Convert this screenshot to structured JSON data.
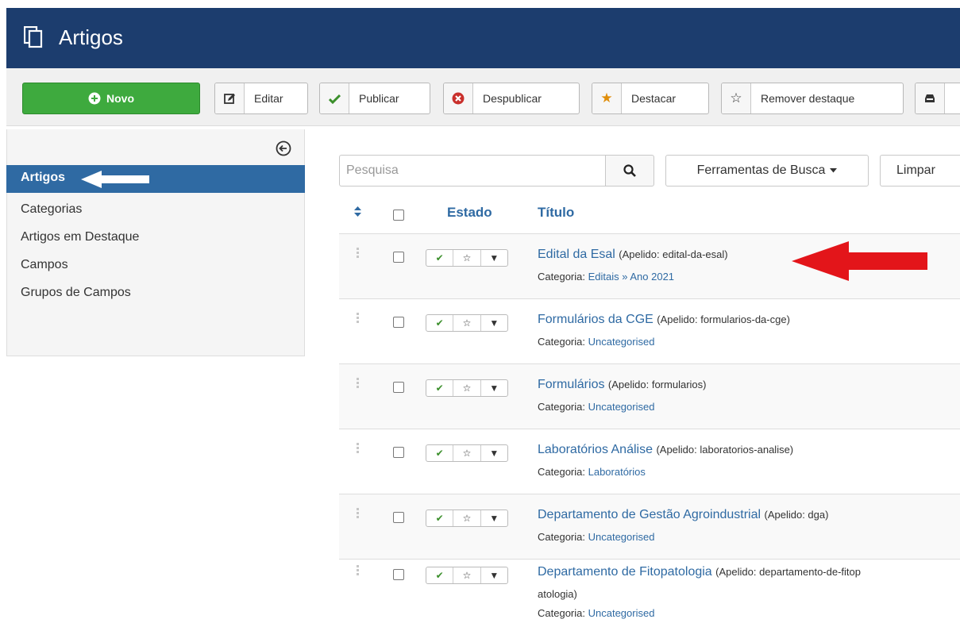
{
  "header": {
    "title": "Artigos",
    "icon": "copy-icon",
    "bg_color": "#1c3d6e"
  },
  "toolbar": {
    "new_label": "Novo",
    "edit_label": "Editar",
    "publish_label": "Publicar",
    "unpublish_label": "Despublicar",
    "feature_label": "Destacar",
    "unfeature_label": "Remover destaque"
  },
  "sidebar": {
    "items": [
      {
        "label": "Artigos",
        "active": true
      },
      {
        "label": "Categorias"
      },
      {
        "label": "Artigos em Destaque"
      },
      {
        "label": "Campos"
      },
      {
        "label": "Grupos de Campos"
      }
    ]
  },
  "search": {
    "placeholder": "Pesquisa",
    "tools_label": "Ferramentas de Busca",
    "clear_label": "Limpar"
  },
  "table": {
    "headers": {
      "state": "Estado",
      "title": "Título"
    },
    "alias_prefix": "Apelido:",
    "category_prefix": "Categoria:",
    "rows": [
      {
        "title": "Edital da Esal",
        "alias": "(Apelido: edital-da-esal)",
        "category": "Editais » Ano 2021"
      },
      {
        "title": "Formulários da CGE",
        "alias": "(Apelido: formularios-da-cge)",
        "category": "Uncategorised"
      },
      {
        "title": "Formulários",
        "alias": "(Apelido: formularios)",
        "category": "Uncategorised"
      },
      {
        "title": "Laboratórios Análise",
        "alias": "(Apelido: laboratorios-analise)",
        "category": "Laboratórios"
      },
      {
        "title": "Departamento de Gestão Agroindustrial",
        "alias": "(Apelido: dga)",
        "category": "Uncategorised"
      },
      {
        "title": "Departamento de Fitopatologia",
        "alias": "(Apelido: departamento-de-fitop",
        "alias_cont": "atologia)",
        "category": "Uncategorised"
      }
    ]
  },
  "colors": {
    "accent": "#2f6aa3",
    "success": "#3eaa3e",
    "annotation_arrow": "#e3151a"
  }
}
